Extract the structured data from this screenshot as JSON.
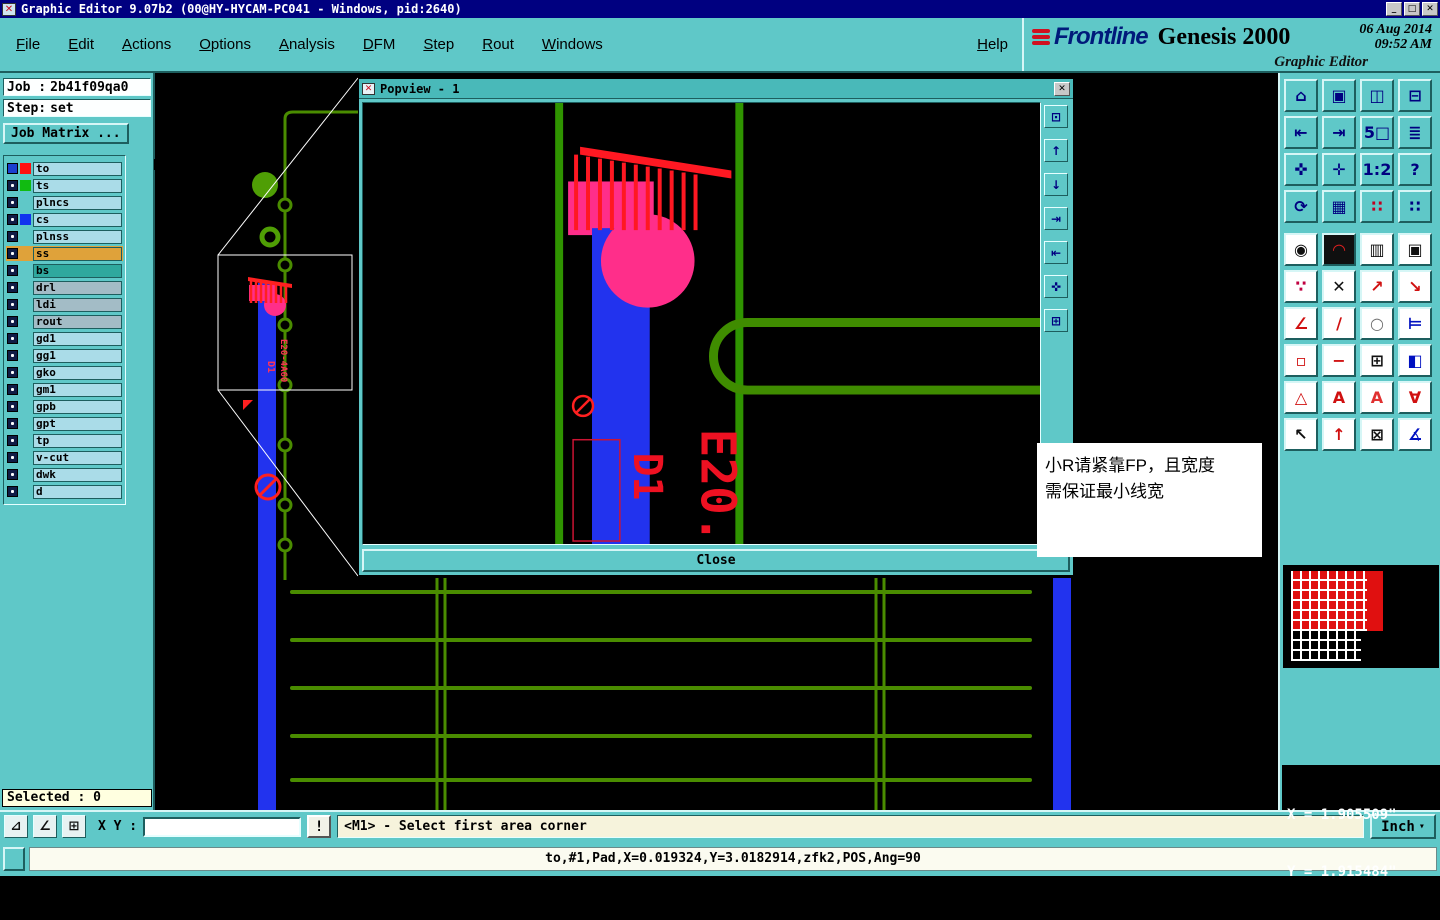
{
  "title_bar": {
    "icon": "✕",
    "title": "Graphic Editor 9.07b2 (00@HY-HYCAM-PC041 - Windows, pid:2640)",
    "window_buttons": [
      {
        "name": "minimize-button",
        "glyph": "_"
      },
      {
        "name": "maximize-button",
        "glyph": "□"
      },
      {
        "name": "close-button",
        "glyph": "✕"
      }
    ]
  },
  "menu_bar": {
    "items": [
      {
        "name": "menu-file",
        "label": "File"
      },
      {
        "name": "menu-edit",
        "label": "Edit"
      },
      {
        "name": "menu-actions",
        "label": "Actions"
      },
      {
        "name": "menu-options",
        "label": "Options"
      },
      {
        "name": "menu-analysis",
        "label": "Analysis"
      },
      {
        "name": "menu-dfm",
        "label": "DFM"
      },
      {
        "name": "menu-step",
        "label": "Step"
      },
      {
        "name": "menu-rout",
        "label": "Rout"
      },
      {
        "name": "menu-windows",
        "label": "Windows"
      }
    ],
    "help_label": "Help"
  },
  "branding": {
    "logo_text": "Frontline",
    "product": "Genesis 2000",
    "date": "06 Aug 2014",
    "time": "09:52 AM",
    "subtitle": "Graphic Editor"
  },
  "job_panel": {
    "job_label": "Job :",
    "job_value": "2b41f09qa0",
    "step_label": "Step:",
    "step_value": "set",
    "matrix_button": "Job Matrix ..."
  },
  "layers": [
    {
      "name": "to",
      "swatch": "#ff1010",
      "checkbox_bg": "#1b3fd0"
    },
    {
      "name": "ts",
      "swatch": "#11bb11"
    },
    {
      "name": "plncs"
    },
    {
      "name": "cs",
      "swatch": "#1133ee"
    },
    {
      "name": "plnss"
    },
    {
      "name": "ss",
      "row_bg": "#dfa23a",
      "field_bg": "#dfa23a"
    },
    {
      "name": "bs",
      "field_bg": "#2fa89e"
    },
    {
      "name": "drl",
      "field_bg": "#a3bcc6"
    },
    {
      "name": "ldi",
      "field_bg": "#a3bcc6"
    },
    {
      "name": "rout",
      "field_bg": "#a3bcc6"
    },
    {
      "name": "gd1"
    },
    {
      "name": "gg1"
    },
    {
      "name": "gko"
    },
    {
      "name": "gm1"
    },
    {
      "name": "gpb"
    },
    {
      "name": "gpt"
    },
    {
      "name": "tp"
    },
    {
      "name": "v-cut"
    },
    {
      "name": "dwk"
    },
    {
      "name": "d"
    }
  ],
  "selected_box": "Selected : 0",
  "popup": {
    "icon": "✕",
    "title": "Popview - 1",
    "close_icon": "✕",
    "close_button": "Close",
    "tools": [
      {
        "name": "popview-grab-button",
        "glyph": "⊡"
      },
      {
        "name": "pan-up-button",
        "glyph": "↑"
      },
      {
        "name": "pan-down-button",
        "glyph": "↓"
      },
      {
        "name": "pan-right-button",
        "glyph": "⇥"
      },
      {
        "name": "pan-left-button",
        "glyph": "⇤"
      },
      {
        "name": "zoom-extents-button",
        "glyph": "✜"
      },
      {
        "name": "zoom-window-button",
        "glyph": "⊞"
      }
    ]
  },
  "canvas_labels": {
    "mini_ref1": "E20-4A60",
    "mini_ref2": "D1",
    "popup_ref1": "E20.",
    "popup_ref2": "D1"
  },
  "annotation": {
    "line1": "小R请紧靠FP，且宽度",
    "line2": "需保证最小线宽"
  },
  "toolbar": {
    "block_a": [
      {
        "name": "view-home-button",
        "glyph": "⌂"
      },
      {
        "name": "view-full-button",
        "glyph": "▣"
      },
      {
        "name": "view-tile-button",
        "glyph": "◫"
      },
      {
        "name": "view-split-button",
        "glyph": "⊟"
      },
      {
        "name": "view-prev-button",
        "glyph": "⇤"
      },
      {
        "name": "view-next-button",
        "glyph": "⇥"
      },
      {
        "name": "zoom-5x-button",
        "glyph": "5□"
      },
      {
        "name": "layer-stack-button",
        "glyph": "≣"
      },
      {
        "name": "zoom-margins-button",
        "glyph": "✜"
      },
      {
        "name": "zoom-center-button",
        "glyph": "✛"
      },
      {
        "name": "zoom-ratio-button",
        "glyph": "1:2"
      },
      {
        "name": "help-tool-button",
        "glyph": "?"
      },
      {
        "name": "redraw-button",
        "glyph": "⟳"
      },
      {
        "name": "grid-toggle-button",
        "glyph": "▦"
      },
      {
        "name": "color-palette-a-button",
        "glyph": "∷",
        "fg": "#c00020"
      },
      {
        "name": "color-palette-b-button",
        "glyph": "∷",
        "fg": "#000080"
      }
    ],
    "block_b": [
      {
        "name": "select-point-button",
        "glyph": "◉"
      },
      {
        "name": "arc-tool-button",
        "glyph": "◠",
        "fg": "#e02020",
        "bg": "#101010"
      },
      {
        "name": "hatch-tool-button",
        "glyph": "▥"
      },
      {
        "name": "pad-tool-button",
        "glyph": "▣"
      },
      {
        "name": "net-list-button",
        "glyph": "∵",
        "fg": "#c00040"
      },
      {
        "name": "delete-tool-button",
        "glyph": "✕"
      },
      {
        "name": "measure-a-button",
        "glyph": "↗",
        "fg": "#d01010"
      },
      {
        "name": "measure-b-button",
        "glyph": "↘",
        "fg": "#d01010"
      },
      {
        "name": "angle-tool-button",
        "glyph": "∠",
        "fg": "#d01010"
      },
      {
        "name": "slope-tool-button",
        "glyph": "∕",
        "fg": "#d01010"
      },
      {
        "name": "circle-tool-button",
        "glyph": "○",
        "fg": "#707070"
      },
      {
        "name": "flip-tool-button",
        "glyph": "⊨",
        "fg": "#0010c0"
      },
      {
        "name": "pad-swap-button",
        "glyph": "▫",
        "fg": "#d01010"
      },
      {
        "name": "erase-line-button",
        "glyph": "−",
        "fg": "#d01010"
      },
      {
        "name": "array-copy-button",
        "glyph": "⊞"
      },
      {
        "name": "shape-fill-button",
        "glyph": "◧",
        "fg": "#0010c0"
      },
      {
        "name": "text-frame-button",
        "glyph": "△",
        "fg": "#d01010"
      },
      {
        "name": "text-outline-button",
        "glyph": "A",
        "fg": "#d01010"
      },
      {
        "name": "text-fill-button",
        "glyph": "A",
        "fg": "#e03030"
      },
      {
        "name": "text-rotate-button",
        "glyph": "∀",
        "fg": "#d01010"
      },
      {
        "name": "cursor-standard-button",
        "glyph": "↖"
      },
      {
        "name": "cursor-snap-button",
        "glyph": "↑",
        "fg": "#d01010"
      },
      {
        "name": "cursor-window-button",
        "glyph": "⊠"
      },
      {
        "name": "cursor-angle-button",
        "glyph": "∡",
        "fg": "#0010c0"
      }
    ]
  },
  "coords_panel": {
    "x": "X = 1.905509\"",
    "y": "Y = 1.915484\""
  },
  "status_bar": {
    "tools": [
      {
        "name": "snap-corner-button",
        "glyph": "⊿"
      },
      {
        "name": "snap-angle-button",
        "glyph": "∠"
      },
      {
        "name": "grid-button",
        "glyph": "⊞"
      }
    ],
    "xy_label": "X Y :",
    "xy_value": "",
    "alert_label": "!",
    "prompt": "<M1> - Select first area corner",
    "units_label": "Inch",
    "units_caret": "▾"
  },
  "footer": {
    "text": "to,#1,Pad,X=0.019324,Y=3.0182914,zfk2,POS,Ang=90"
  }
}
